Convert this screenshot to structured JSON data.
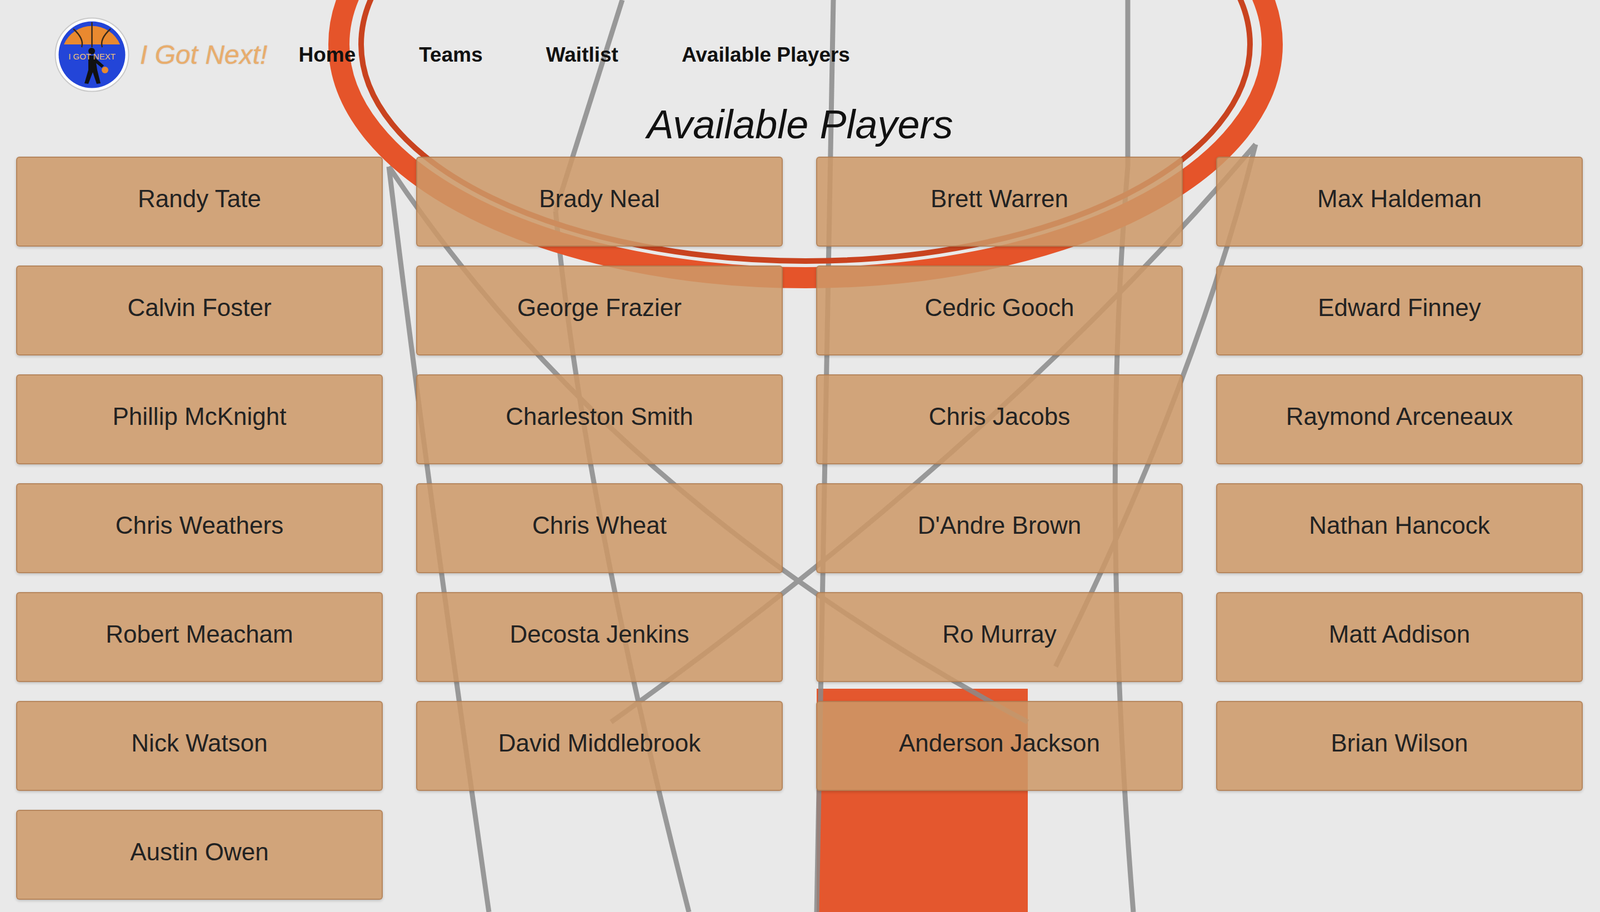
{
  "logo": {
    "badge_text": "I GOT NEXT",
    "title": "I Got Next!"
  },
  "nav": [
    {
      "label": "Home"
    },
    {
      "label": "Teams"
    },
    {
      "label": "Waitlist"
    },
    {
      "label": "Available Players"
    }
  ],
  "heading": "Available Players",
  "players": [
    "Randy Tate",
    "Brady Neal",
    "Brett Warren",
    "Max Haldeman",
    "Calvin Foster",
    "George Frazier",
    "Cedric Gooch",
    "Edward Finney",
    "Phillip McKnight",
    "Charleston Smith",
    "Chris Jacobs",
    "Raymond Arceneaux",
    "Chris Weathers",
    "Chris Wheat",
    "D'Andre Brown",
    "Nathan Hancock",
    "Robert Meacham",
    "Decosta Jenkins",
    "Ro Murray",
    "Matt Addison",
    "Nick Watson",
    "David Middlebrook",
    "Anderson Jackson",
    "Brian Wilson",
    "Austin Owen"
  ]
}
